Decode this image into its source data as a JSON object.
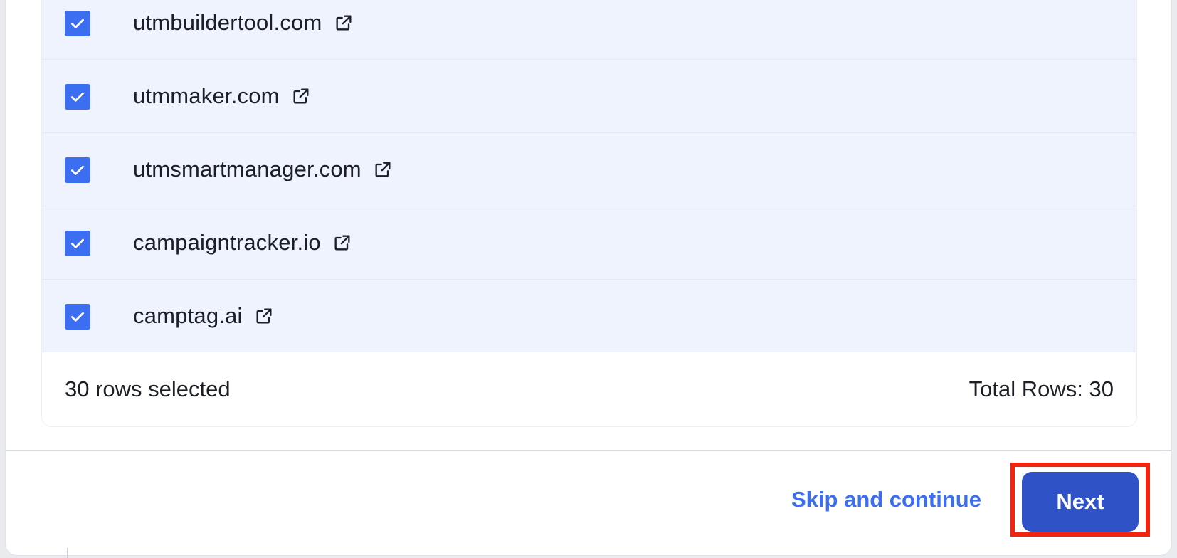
{
  "rows": [
    {
      "domain": "utmbuildertool.com",
      "checked": true
    },
    {
      "domain": "utmmaker.com",
      "checked": true
    },
    {
      "domain": "utmsmartmanager.com",
      "checked": true
    },
    {
      "domain": "campaigntracker.io",
      "checked": true
    },
    {
      "domain": "camptag.ai",
      "checked": true
    }
  ],
  "table_footer": {
    "selected_text": "30 rows selected",
    "total_text": "Total Rows: 30"
  },
  "actions": {
    "skip_label": "Skip and continue",
    "next_label": "Next"
  },
  "icons": {
    "checkbox": "checkbox-checked-icon",
    "external_link": "external-link-icon"
  },
  "colors": {
    "accent": "#3b6ef0",
    "next_button": "#2f52c7",
    "row_selected_bg": "#eef3fe",
    "highlight": "#f2230f"
  }
}
